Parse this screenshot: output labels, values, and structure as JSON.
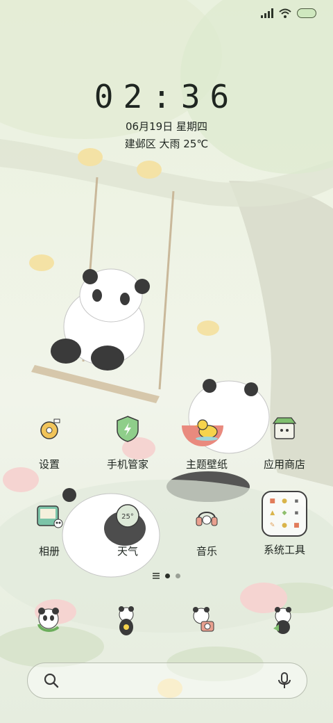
{
  "status": {
    "icons": [
      "signal-icon",
      "wifi-icon",
      "battery-icon"
    ]
  },
  "lockinfo": {
    "time": "02:36",
    "date": "06月19日 星期四",
    "weather": "建邺区 大雨 25℃"
  },
  "apps": [
    {
      "name": "settings",
      "label": "设置"
    },
    {
      "name": "phone-manager",
      "label": "手机管家"
    },
    {
      "name": "theme-wallpaper",
      "label": "主题壁纸"
    },
    {
      "name": "app-store",
      "label": "应用商店"
    },
    {
      "name": "gallery",
      "label": "相册"
    },
    {
      "name": "weather",
      "label": "天气",
      "icon_text": "25°"
    },
    {
      "name": "music",
      "label": "音乐"
    },
    {
      "name": "system-tools",
      "label": "系统工具"
    }
  ],
  "pager": {
    "pages": 2,
    "active": 1
  },
  "dock": [
    "phone",
    "contacts",
    "camera",
    "messages"
  ],
  "colors": {
    "text": "#1e2520",
    "accent_green": "#5aa06b",
    "battery": "#cfe8bf"
  }
}
